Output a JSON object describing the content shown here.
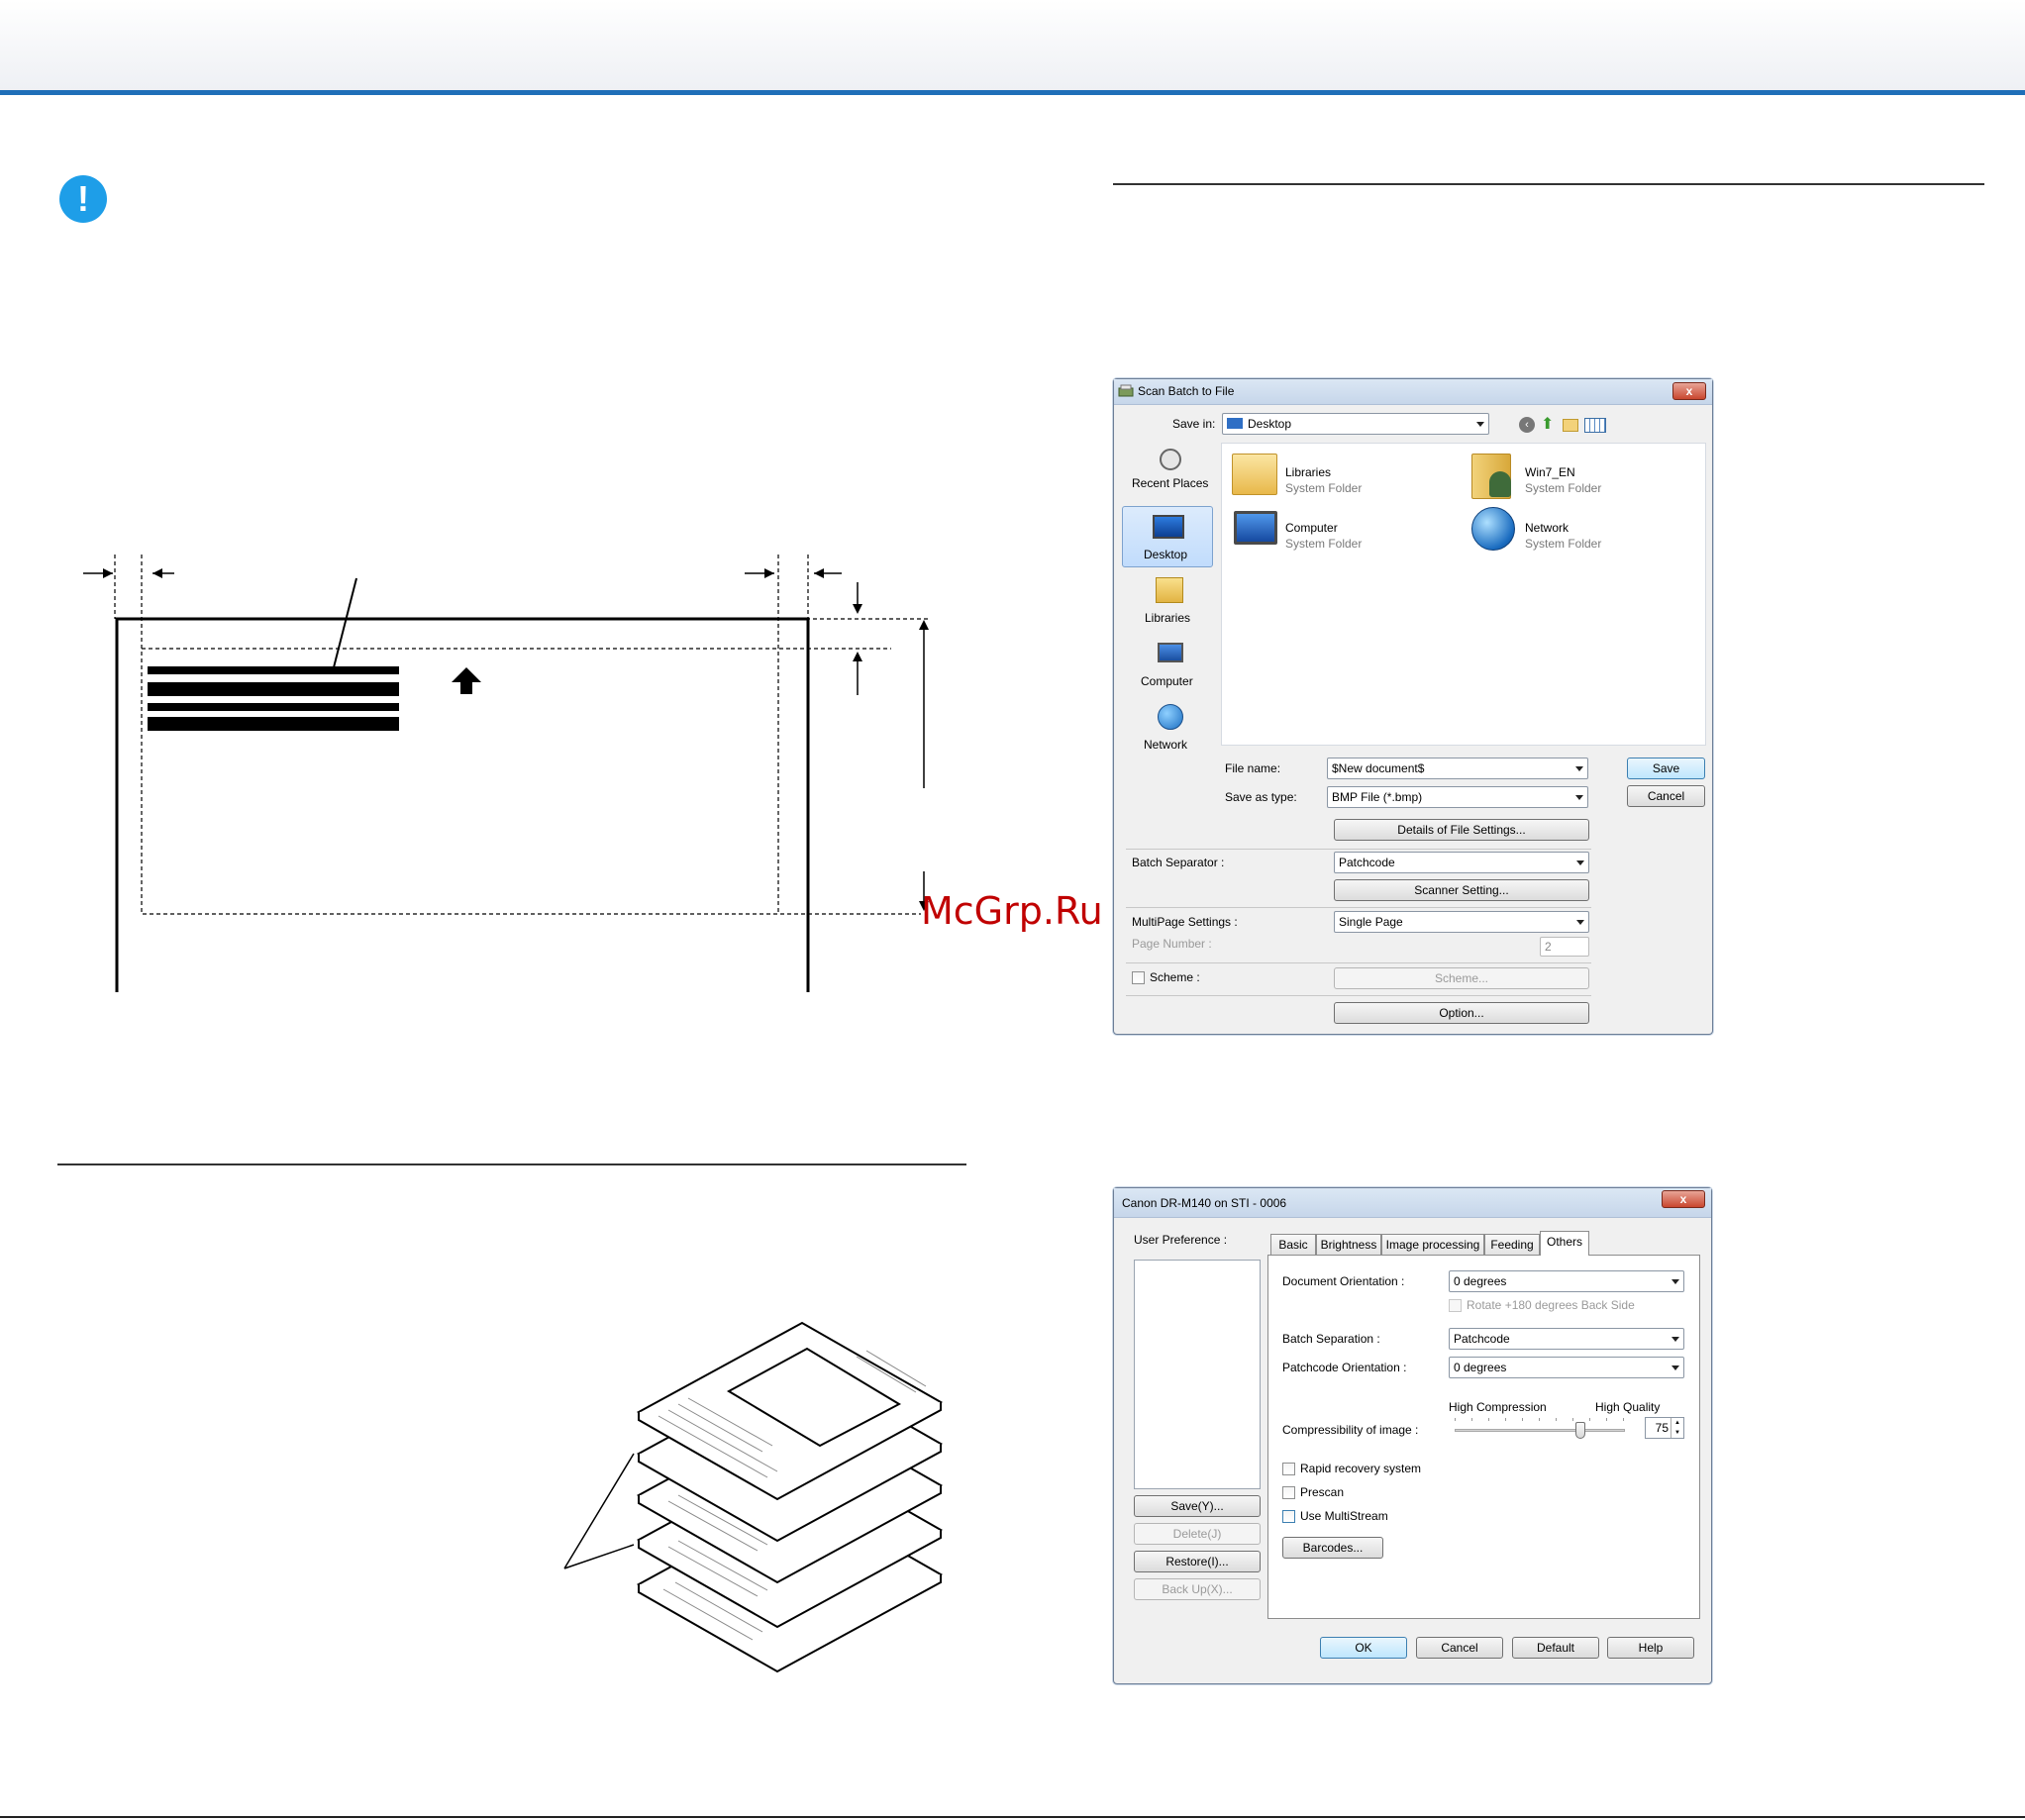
{
  "watermark": "McGrp.Ru",
  "save_dialog": {
    "title": "Scan Batch to File",
    "close": "x",
    "save_in_label": "Save in:",
    "save_in_value": "Desktop",
    "places": [
      "Recent Places",
      "Desktop",
      "Libraries",
      "Computer",
      "Network"
    ],
    "items": [
      {
        "name": "Libraries",
        "type": "System Folder"
      },
      {
        "name": "Win7_EN",
        "type": "System Folder"
      },
      {
        "name": "Computer",
        "type": "System Folder"
      },
      {
        "name": "Network",
        "type": "System Folder"
      }
    ],
    "file_name_label": "File name:",
    "file_name_value": "$New document$",
    "save_type_label": "Save as type:",
    "save_type_value": "BMP File (*.bmp)",
    "save_btn": "Save",
    "cancel_btn": "Cancel",
    "details_btn": "Details of File Settings...",
    "batch_sep_label": "Batch Separator :",
    "batch_sep_value": "Patchcode",
    "scanner_setting_btn": "Scanner Setting...",
    "multipage_label": "MultiPage Settings :",
    "multipage_value": "Single Page",
    "page_number_label": "Page Number :",
    "page_number_value": "2",
    "scheme_label": "Scheme :",
    "scheme_btn": "Scheme...",
    "option_btn": "Option..."
  },
  "driver_dialog": {
    "title": "Canon DR-M140 on STI - 0006",
    "close": "x",
    "user_pref_label": "User Preference :",
    "save_btn": "Save(Y)...",
    "delete_btn": "Delete(J)",
    "restore_btn": "Restore(I)...",
    "backup_btn": "Back Up(X)...",
    "tabs": [
      "Basic",
      "Brightness",
      "Image processing",
      "Feeding",
      "Others"
    ],
    "doc_orient_label": "Document Orientation :",
    "doc_orient_value": "0 degrees",
    "rotate_label": "Rotate +180 degrees Back Side",
    "batch_sep_label": "Batch Separation :",
    "batch_sep_value": "Patchcode",
    "patch_orient_label": "Patchcode Orientation :",
    "patch_orient_value": "0 degrees",
    "high_comp": "High Compression",
    "high_qual": "High Quality",
    "compress_label": "Compressibility of image :",
    "compress_value": "75",
    "compress_level": 0.75,
    "rapid_label": "Rapid recovery system",
    "prescan_label": "Prescan",
    "multistream_label": "Use MultiStream",
    "barcodes_btn": "Barcodes...",
    "ok_btn": "OK",
    "cancel_btn": "Cancel",
    "default_btn": "Default",
    "help_btn": "Help"
  }
}
